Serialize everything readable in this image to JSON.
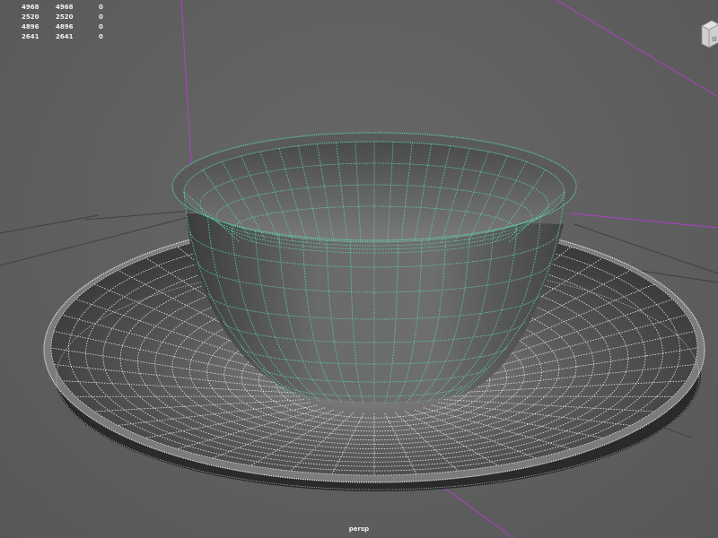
{
  "hud": {
    "rows": [
      {
        "c1": "2452",
        "c2": "2452",
        "c3": "0"
      },
      {
        "c1": "4968",
        "c2": "4968",
        "c3": "0"
      },
      {
        "c1": "2520",
        "c2": "2520",
        "c3": "0"
      },
      {
        "c1": "4896",
        "c2": "4896",
        "c3": "0"
      },
      {
        "c1": "2641",
        "c2": "2641",
        "c3": "0"
      }
    ]
  },
  "camera": {
    "label": "persp"
  },
  "viewcube": {
    "icon": "view-cube-icon"
  },
  "colors": {
    "background": "#5f5f5f",
    "grid_line": "#404040",
    "axis_line": "#b040c8",
    "cup_wire": "#5fd3b0",
    "saucer_wire": "#e8e8e8"
  }
}
